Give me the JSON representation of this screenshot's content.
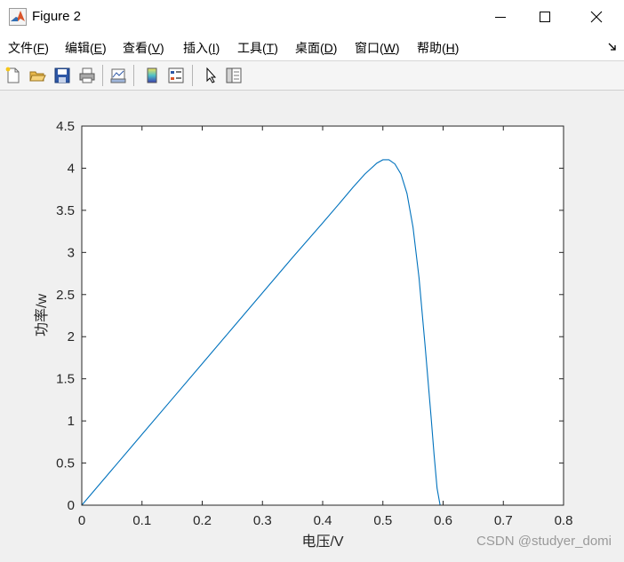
{
  "window": {
    "title": "Figure 2"
  },
  "menu": {
    "items": [
      {
        "label": "文件",
        "mnemonic": "F"
      },
      {
        "label": "编辑",
        "mnemonic": "E"
      },
      {
        "label": "查看",
        "mnemonic": "V"
      },
      {
        "label": "插入",
        "mnemonic": "I"
      },
      {
        "label": "工具",
        "mnemonic": "T"
      },
      {
        "label": "桌面",
        "mnemonic": "D"
      },
      {
        "label": "窗口",
        "mnemonic": "W"
      },
      {
        "label": "帮助",
        "mnemonic": "H"
      }
    ]
  },
  "toolbar": {
    "icons": [
      "new-figure-icon",
      "open-file-icon",
      "save-icon",
      "print-icon",
      "link-plot-icon",
      "colorbar-icon",
      "legend-icon",
      "edit-plot-arrow-icon",
      "property-inspector-icon"
    ]
  },
  "chart_data": {
    "type": "line",
    "title": "",
    "xlabel": "电压/V",
    "ylabel": "功率/w",
    "xlim": [
      0,
      0.8
    ],
    "ylim": [
      0,
      4.5
    ],
    "xticks": [
      "0",
      "0.1",
      "0.2",
      "0.3",
      "0.4",
      "0.5",
      "0.6",
      "0.7",
      "0.8"
    ],
    "yticks": [
      "0",
      "0.5",
      "1",
      "1.5",
      "2",
      "2.5",
      "3",
      "3.5",
      "4",
      "4.5"
    ],
    "grid": false,
    "line_color": "#0072bd",
    "series": [
      {
        "x": [
          0,
          0.05,
          0.1,
          0.15,
          0.2,
          0.25,
          0.3,
          0.35,
          0.4,
          0.43,
          0.45,
          0.47,
          0.49,
          0.5,
          0.51,
          0.52,
          0.53,
          0.54,
          0.55,
          0.56,
          0.57,
          0.58,
          0.585,
          0.59,
          0.595,
          0.6,
          0.65,
          0.7,
          0.75,
          0.8
        ],
        "y": [
          0,
          0.42,
          0.84,
          1.26,
          1.68,
          2.1,
          2.52,
          2.94,
          3.35,
          3.6,
          3.77,
          3.93,
          4.06,
          4.1,
          4.1,
          4.05,
          3.93,
          3.7,
          3.3,
          2.7,
          1.9,
          1.05,
          0.6,
          0.2,
          0,
          0,
          0,
          0,
          0,
          0
        ]
      }
    ]
  },
  "watermark": "CSDN @studyer_domi"
}
